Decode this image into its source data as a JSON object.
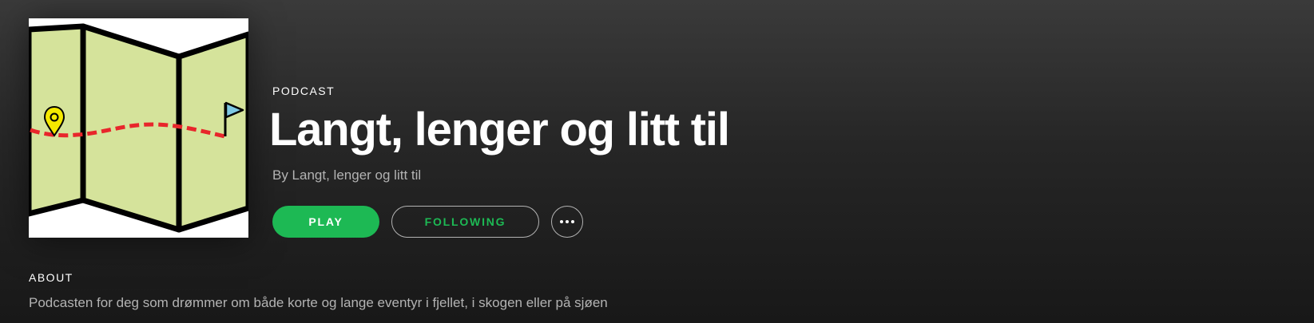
{
  "podcast": {
    "type_label": "PODCAST",
    "title": "Langt, lenger og litt til",
    "byline": "By Langt, lenger og litt til",
    "cover_icon": "folded-map-with-route-icon"
  },
  "actions": {
    "play_label": "PLAY",
    "follow_label": "FOLLOWING",
    "more_icon": "ellipsis-icon"
  },
  "about": {
    "heading": "ABOUT",
    "description": "Podcasten for deg som drømmer om både korte og lange eventyr i fjellet, i skogen eller på sjøen"
  },
  "colors": {
    "accent": "#1db954",
    "secondary_text": "#b3b3b3",
    "map_fill": "#d5e39b",
    "route": "#e8262b",
    "pin": "#f5e800",
    "flag": "#7ec8e3"
  }
}
